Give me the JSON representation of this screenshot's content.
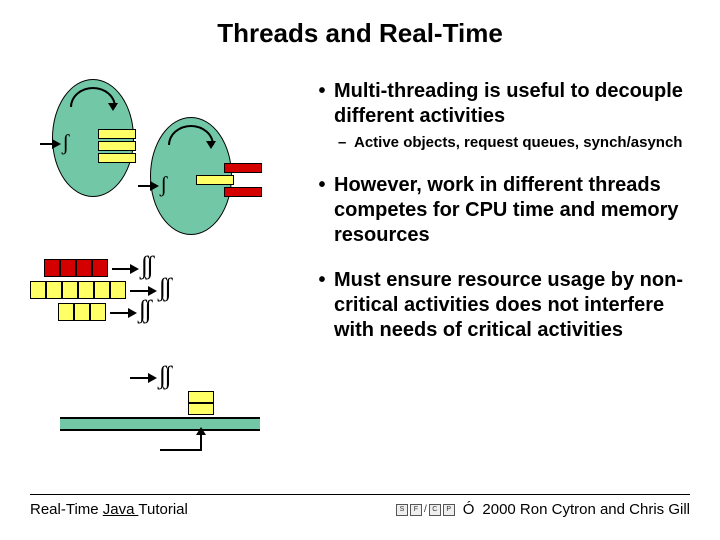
{
  "title": "Threads and Real-Time",
  "bullets": [
    {
      "main": "Multi-threading is useful to decouple different activities",
      "sub": "Active objects, request queues, synch/asynch"
    },
    {
      "main": "However, work in different threads competes for CPU time and memory resources"
    },
    {
      "main": "Must ensure resource usage by non-critical activities does not interfere with needs of critical activities"
    }
  ],
  "footer": {
    "left_pre": "Real-Time ",
    "left_underline": "Java ",
    "left_post": "Tutorial",
    "right": "2000 Ron Cytron and Chris Gill",
    "copyright_symbol": "Ó"
  }
}
